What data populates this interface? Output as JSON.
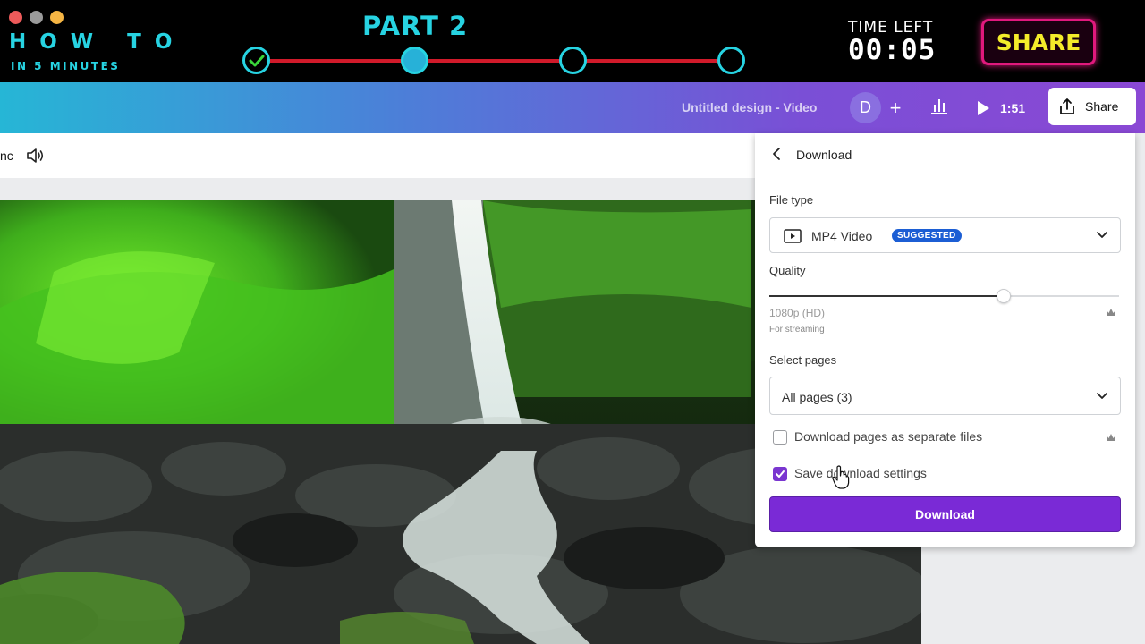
{
  "banner": {
    "window_dot_colors": [
      "#ed5a5a",
      "#9a9a9a",
      "#f5b544"
    ],
    "how_to": "HOW TO",
    "subtitle": "IN 5 MINUTES",
    "part": "PART 2",
    "steps": [
      "complete",
      "current",
      "upcoming",
      "upcoming"
    ],
    "time_left_label": "TIME LEFT",
    "timer": "00:05",
    "share": "SHARE"
  },
  "header": {
    "document_title": "Untitled design - Video",
    "avatar_initial": "D",
    "add_label": "+",
    "duration": "1:51",
    "share_label": "Share"
  },
  "toolbar": {
    "partial_text": "nc"
  },
  "panel": {
    "title": "Download",
    "file_type_label": "File type",
    "file_type_value": "MP4 Video",
    "file_type_badge": "SUGGESTED",
    "quality_label": "Quality",
    "quality_value": "1080p (HD)",
    "quality_note": "For streaming",
    "quality_level": 0.67,
    "select_pages_label": "Select pages",
    "select_pages_value": "All pages (3)",
    "separate_files_label": "Download pages as separate files",
    "separate_files_checked": false,
    "save_settings_label": "Save download settings",
    "save_settings_checked": true,
    "download_button": "Download"
  },
  "colors": {
    "accent_cyan": "#27d3e2",
    "progress_red": "#d01a2a",
    "download_purple": "#7a2ad6",
    "badge_blue": "#1c5ed4"
  }
}
